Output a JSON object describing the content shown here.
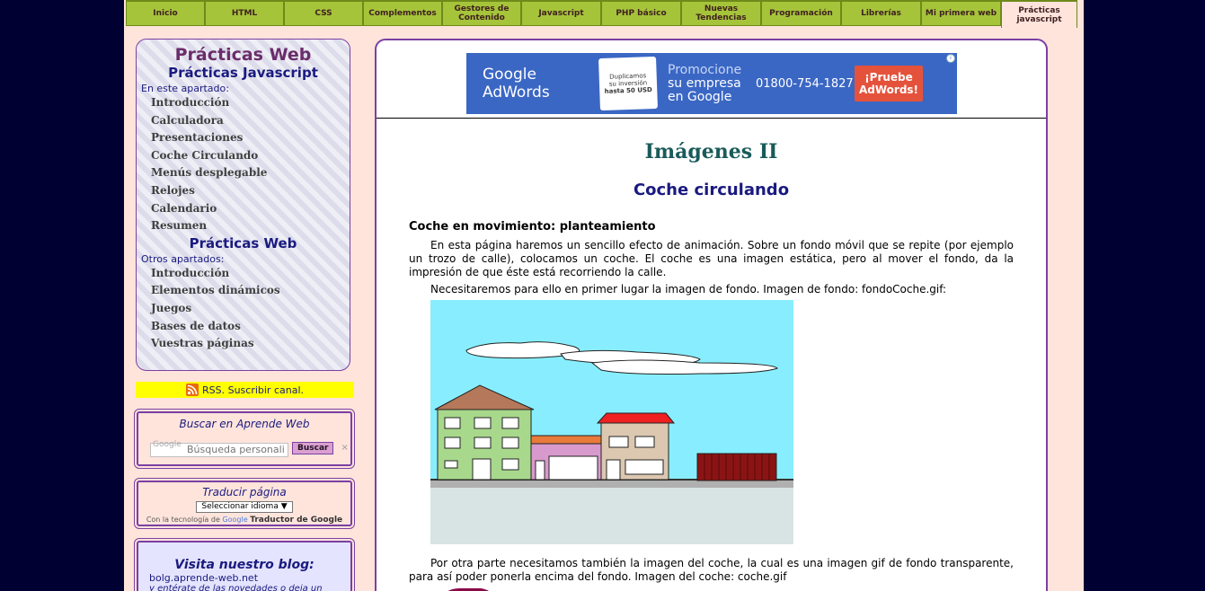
{
  "nav": {
    "tabs": [
      {
        "label": "Inicio",
        "w": 88
      },
      {
        "label": "HTML",
        "w": 88
      },
      {
        "label": "CSS",
        "w": 88
      },
      {
        "label": "Complementos",
        "w": 88
      },
      {
        "label": "Gestores de Contenido",
        "w": 88
      },
      {
        "label": "Javascript",
        "w": 89
      },
      {
        "label": "PHP básico",
        "w": 89
      },
      {
        "label": "Nuevas Tendencias",
        "w": 89
      },
      {
        "label": "Programación",
        "w": 89
      },
      {
        "label": "Librerías",
        "w": 89
      },
      {
        "label": "Mi primera web",
        "w": 89
      },
      {
        "label": "Prácticas javascript",
        "w": 85,
        "active": true
      }
    ]
  },
  "sidebar": {
    "title": "Prácticas Web",
    "section1_title": "Prácticas Javascript",
    "section1_sub": "En este apartado:",
    "section1_items": [
      "Introducción",
      "Calculadora",
      "Presentaciones",
      "Coche Circulando",
      "Menús desplegable",
      "Relojes",
      "Calendario",
      "Resumen"
    ],
    "section2_title": "Prácticas Web",
    "section2_sub": "Otros apartados:",
    "section2_items": [
      "Introducción",
      "Elementos dinámicos",
      "Juegos",
      "Bases de datos",
      "Vuestras páginas"
    ]
  },
  "rss": {
    "label": "RSS. Suscribir canal."
  },
  "search": {
    "title": "Buscar en Aprende Web",
    "placeholder": "Búsqueda personali",
    "google_label": "Google",
    "button": "Buscar",
    "clear": "×"
  },
  "translate": {
    "title": "Traducir página",
    "select": "Seleccionar idioma ▼",
    "powered_prefix": "Con la tecnología de",
    "google_label": "Google",
    "powered_name": "Traductor de Google"
  },
  "blog": {
    "title": "Visita nuestro blog:",
    "link": "bolg.aprende-web.net",
    "note": "y entérate de las novedades o deja un"
  },
  "ad": {
    "brand": "Google AdWords",
    "card_l1": "Duplicamos",
    "card_l2": "su inversión",
    "card_l3": "hasta 50 USD",
    "promo_l1": "Promocione",
    "promo_l2": "su empresa",
    "promo_l3": "en Google",
    "phone": "01800-754-1827",
    "cta_l1": "¡Pruebe",
    "cta_l2": "AdWords!"
  },
  "content": {
    "h1": "Imágenes II",
    "h2": "Coche circulando",
    "h3": "Coche en movimiento: planteamiento",
    "p1": "En esta página haremos un sencillo efecto de animación. Sobre un fondo móvil que se repite (por ejemplo un trozo de calle), colocamos un coche. El coche es una imagen estática, pero al mover el fondo, da la impresión de que éste está recorriendo la calle.",
    "p2": "Necesitaremos para ello en primer lugar la imagen de fondo. Imagen de fondo: fondoCoche.gif:",
    "p3": "Por otra parte necesitamos también la imagen del coche, la cual es una imagen gif de fondo transparente, para así poder ponerla encima del fondo. Imagen del coche: coche.gif"
  },
  "colors": {
    "nav_bg": "#a5c43a",
    "page_bg": "#ffe4dc",
    "outer_bg": "#000033",
    "border": "#7b3fa3",
    "sky": "#88eeff"
  }
}
